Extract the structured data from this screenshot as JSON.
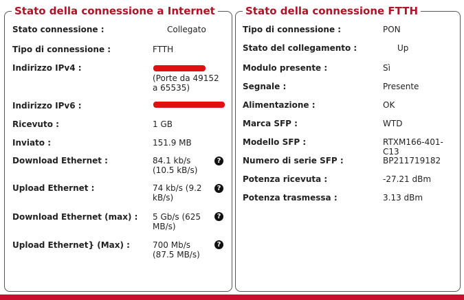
{
  "internet": {
    "title": "Stato della connessione a Internet",
    "rows": [
      {
        "label": "Stato connessione :",
        "value": "Collegato"
      },
      {
        "label": "Tipo di connessione :",
        "value": "FTTH"
      },
      {
        "label": "Indirizzo IPv4 :",
        "value": "(Porte da 49152 a 65535)"
      },
      {
        "label": "Indirizzo IPv6 :",
        "value": ""
      },
      {
        "label": "Ricevuto :",
        "value": "1 GB"
      },
      {
        "label": "Inviato :",
        "value": "151.9 MB"
      },
      {
        "label": "Download Ethernet :",
        "value": "84.1 kb/s (10.5 kB/s)"
      },
      {
        "label": "Upload Ethernet :",
        "value": "74 kb/s (9.2 kB/s)"
      },
      {
        "label": "Download Ethernet (max) :",
        "value": "5 Gb/s (625 MB/s)"
      },
      {
        "label": "Upload Ethernet} (Max) :",
        "value": "700 Mb/s (87.5 MB/s)"
      }
    ],
    "help_glyph": "?",
    "redaction_color": "#e01010"
  },
  "ftth": {
    "title": "Stato della connessione FTTH",
    "rows": [
      {
        "label": "Tipo di connessione :",
        "value": "PON"
      },
      {
        "label": "Stato del collegamento :",
        "value": "Up"
      },
      {
        "label": "Modulo presente :",
        "value": "Sì"
      },
      {
        "label": "Segnale :",
        "value": "Presente"
      },
      {
        "label": "Alimentazione :",
        "value": "OK"
      },
      {
        "label": "Marca SFP :",
        "value": "WTD"
      },
      {
        "label": "Modello SFP :",
        "value": "RTXM166-401-C13"
      },
      {
        "label": "Numero di serie SFP :",
        "value": "BP211719182"
      },
      {
        "label": "Potenza ricevuta :",
        "value": "-27.21 dBm"
      },
      {
        "label": "Potenza trasmessa :",
        "value": "3.13 dBm"
      }
    ]
  },
  "colors": {
    "title": "#b01226",
    "brand_red": "#c8102e"
  }
}
